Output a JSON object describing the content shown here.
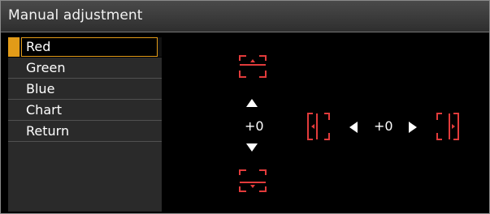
{
  "title": "Manual adjustment",
  "menu": {
    "items": [
      {
        "label": "Red",
        "selected": true
      },
      {
        "label": "Green"
      },
      {
        "label": "Blue"
      },
      {
        "label": "Chart"
      },
      {
        "label": "Return"
      }
    ]
  },
  "vertical": {
    "value": "+0"
  },
  "horizontal": {
    "value": "+0"
  },
  "colors": {
    "accent": "#e29b18",
    "marker_red": "#e23b3b",
    "panel": "#2a2a2a"
  }
}
